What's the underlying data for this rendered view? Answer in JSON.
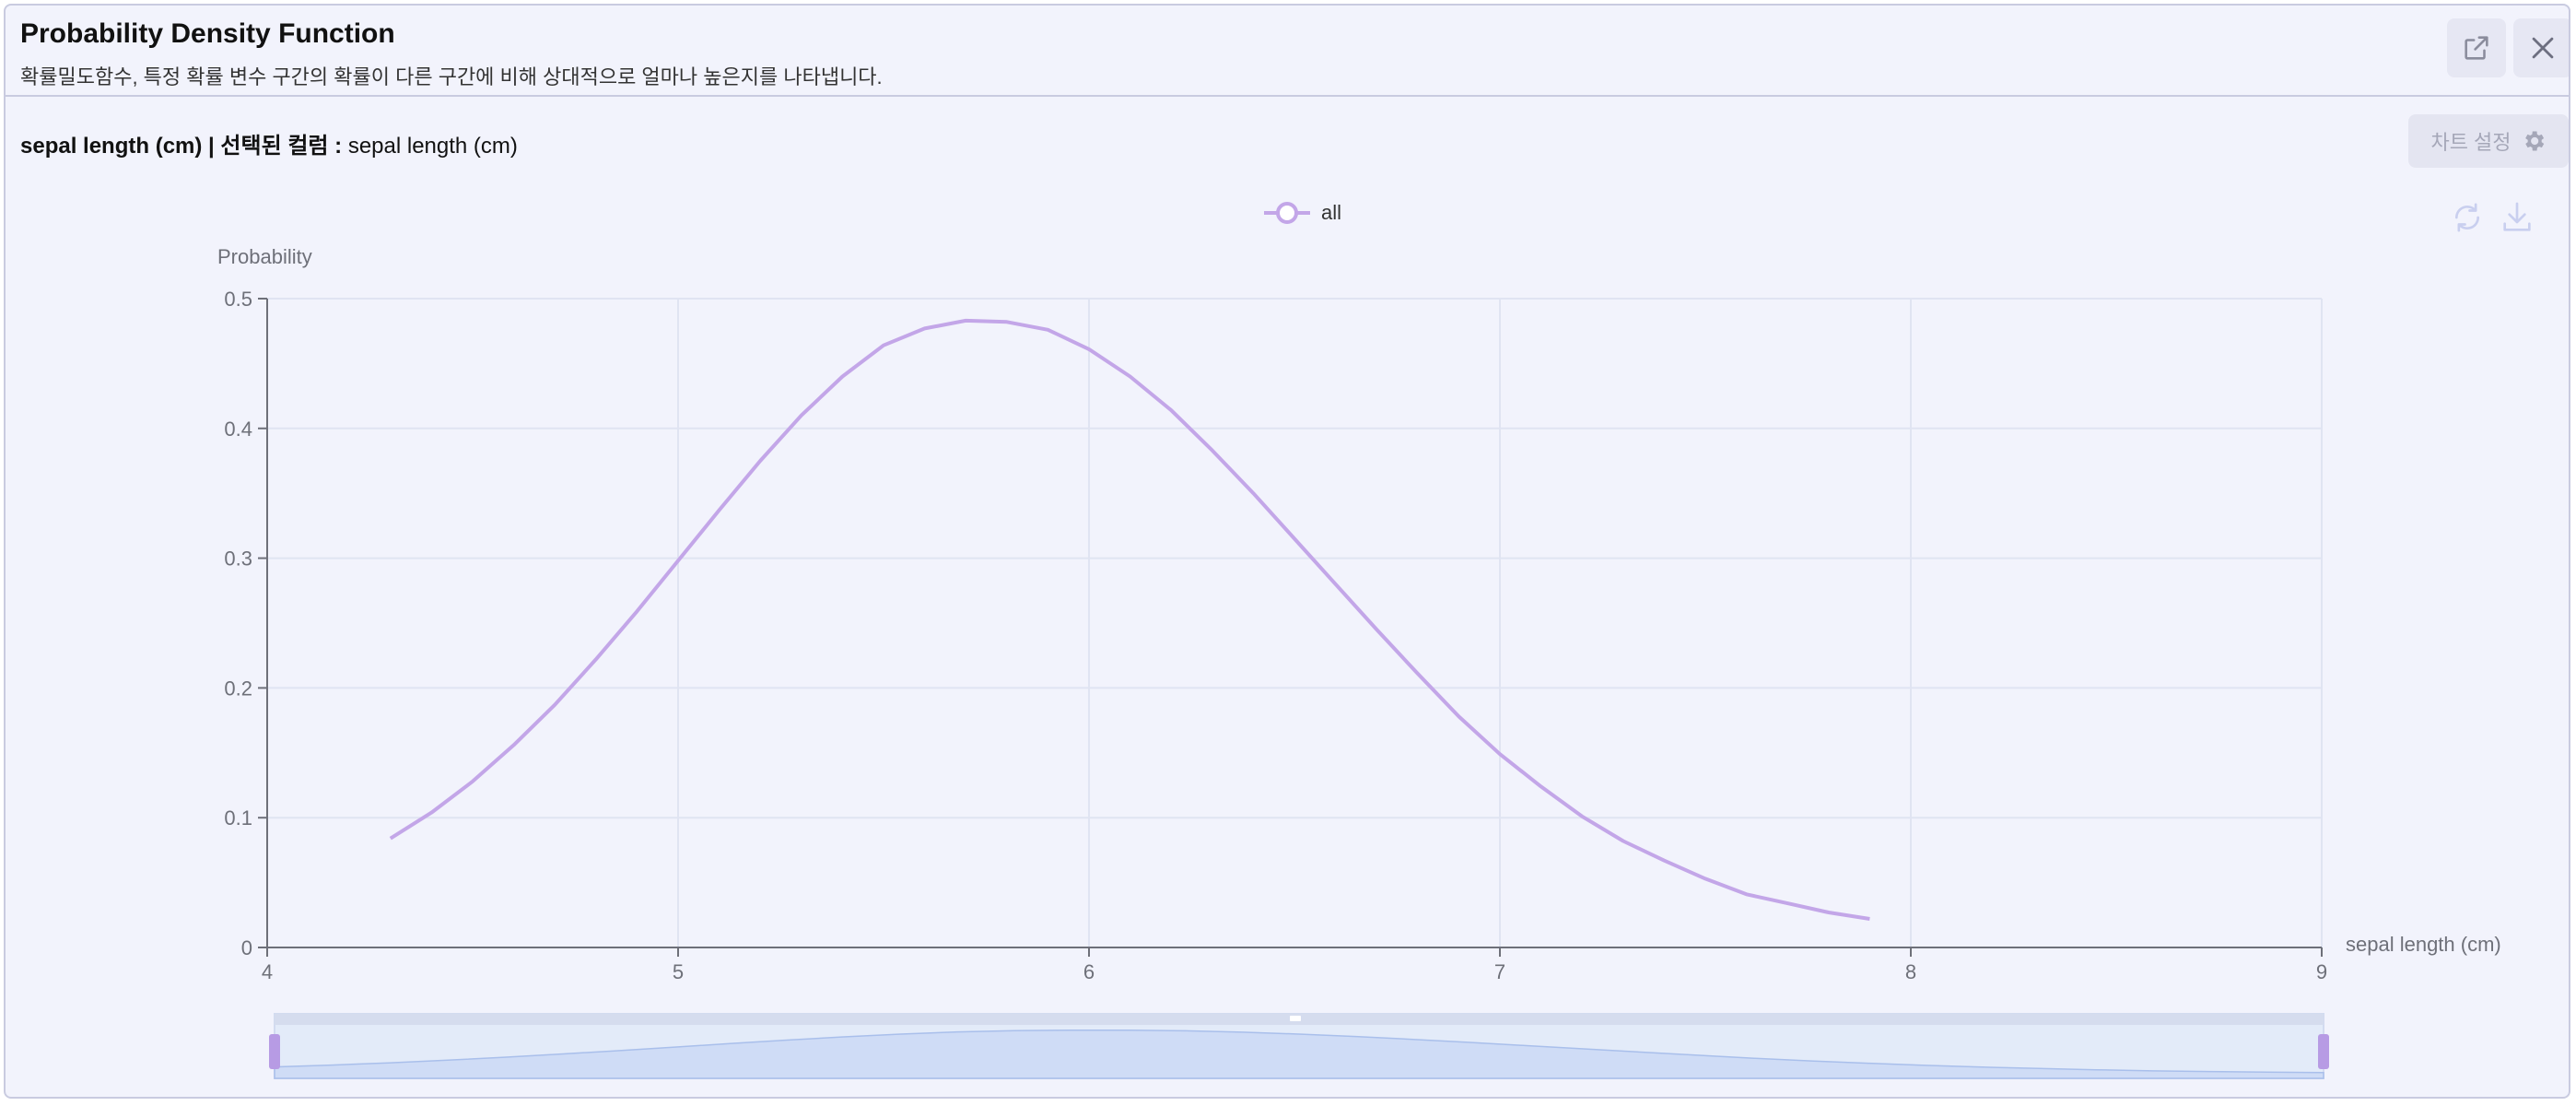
{
  "header": {
    "title": "Probability Density Function",
    "subtitle": "확률밀도함수, 특정 확률 변수 구간의 확률이 다른 구간에 비해 상대적으로 얼마나 높은지를 나타냅니다."
  },
  "toolbar": {
    "column_bold": "sepal length (cm) | 선택된 컬럼 :",
    "column_value": "sepal length (cm)",
    "settings_label": "차트 설정"
  },
  "icons": {
    "open": "external-link-icon",
    "close": "close-icon",
    "settings": "gear-icon",
    "refresh": "refresh-icon",
    "download": "download-icon"
  },
  "colors": {
    "series": "#c3a6e8",
    "axis": "#6e7079",
    "grid": "#e0e4f2",
    "zoom_fill": "#cfdcf6",
    "zoom_handle": "#b79be4"
  },
  "chart_data": {
    "type": "line",
    "xlabel": "sepal length (cm)",
    "ylabel": "Probability",
    "xlim": [
      4,
      9
    ],
    "ylim": [
      0,
      0.5
    ],
    "x_ticks": [
      "4",
      "5",
      "6",
      "7",
      "8",
      "9"
    ],
    "y_ticks": [
      "0",
      "0.1",
      "0.2",
      "0.3",
      "0.4",
      "0.5"
    ],
    "grid": true,
    "legend_position": "top-center",
    "series": [
      {
        "name": "all",
        "x": [
          4.3,
          4.4,
          4.5,
          4.6,
          4.7,
          4.8,
          4.9,
          5.0,
          5.1,
          5.2,
          5.3,
          5.4,
          5.5,
          5.6,
          5.7,
          5.8,
          5.9,
          6.0,
          6.1,
          6.2,
          6.3,
          6.4,
          6.5,
          6.6,
          6.7,
          6.8,
          6.9,
          7.0,
          7.1,
          7.2,
          7.3,
          7.4,
          7.5,
          7.6,
          7.7,
          7.8,
          7.9
        ],
        "y": [
          0.084,
          0.104,
          0.128,
          0.156,
          0.187,
          0.222,
          0.259,
          0.298,
          0.337,
          0.375,
          0.41,
          0.44,
          0.464,
          0.477,
          0.483,
          0.482,
          0.476,
          0.461,
          0.44,
          0.414,
          0.383,
          0.35,
          0.315,
          0.28,
          0.245,
          0.211,
          0.178,
          0.149,
          0.124,
          0.101,
          0.082,
          0.067,
          0.053,
          0.041,
          0.034,
          0.027,
          0.022
        ]
      }
    ],
    "zoom_range": [
      0,
      100
    ]
  }
}
